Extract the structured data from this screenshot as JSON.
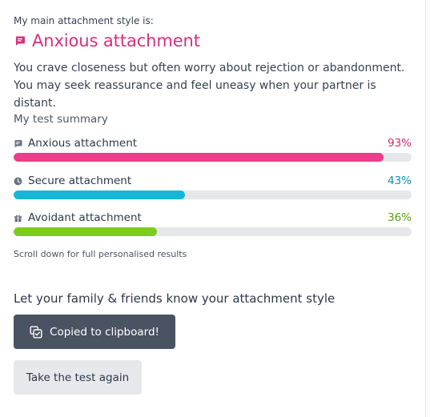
{
  "result": {
    "eyebrow": "My main attachment style is:",
    "title": "Anxious attachment",
    "title_icon": "chat-bubble-icon",
    "description": "You crave closeness but often worry about rejection or abandonment. You may seek reassurance and feel uneasy when your partner is distant."
  },
  "summary": {
    "heading": "My test summary",
    "items": [
      {
        "label": "Anxious attachment",
        "percent": "93%",
        "value": 93,
        "color": "#e8408b",
        "pct_color": "#c9306f",
        "icon": "chat-bubble-icon"
      },
      {
        "label": "Secure attachment",
        "percent": "43%",
        "value": 43,
        "color": "#15b7d8",
        "pct_color": "#0e8fae",
        "icon": "clock-icon"
      },
      {
        "label": "Avoidant attachment",
        "percent": "36%",
        "value": 36,
        "color": "#7dcc1d",
        "pct_color": "#5a9b14",
        "icon": "gift-icon"
      }
    ],
    "scroll_note": "Scroll down for full personalised results"
  },
  "share": {
    "heading": "Let your family & friends know your attachment style",
    "copied_label": "Copied to clipboard!",
    "copied_icon": "copy-check-icon",
    "retake_label": "Take the test again"
  },
  "colors": {
    "accent": "#d6307b",
    "button_dark": "#4a5362",
    "button_light": "#e7e8eb"
  }
}
